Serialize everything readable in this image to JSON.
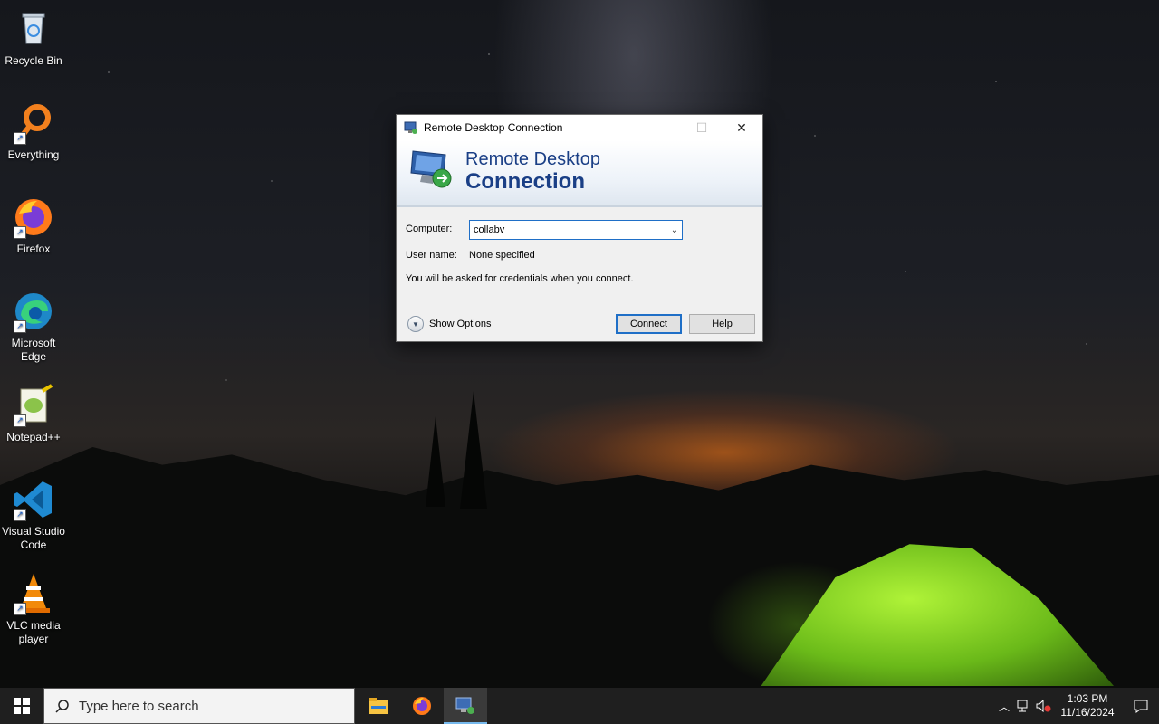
{
  "desktop": {
    "icons": [
      {
        "label": "Recycle Bin",
        "icon": "recycle-bin-icon"
      },
      {
        "label": "Everything",
        "icon": "everything-search-icon"
      },
      {
        "label": "Firefox",
        "icon": "firefox-icon"
      },
      {
        "label": "Microsoft\nEdge",
        "icon": "edge-icon"
      },
      {
        "label": "Notepad++",
        "icon": "notepadpp-icon"
      },
      {
        "label": "Visual Studio\nCode",
        "icon": "vscode-icon"
      },
      {
        "label": "VLC media\nplayer",
        "icon": "vlc-icon"
      }
    ]
  },
  "rdc": {
    "window_title": "Remote Desktop Connection",
    "banner_line1": "Remote Desktop",
    "banner_line2": "Connection",
    "computer_label": "Computer:",
    "computer_value": "collabv",
    "username_label": "User name:",
    "username_value": "None specified",
    "credentials_note": "You will be asked for credentials when you connect.",
    "show_options": "Show Options",
    "connect": "Connect",
    "help": "Help",
    "minimize": "—",
    "maximize": "☐",
    "close": "✕"
  },
  "taskbar": {
    "search_placeholder": "Type here to search",
    "apps": [
      "file-explorer-icon",
      "firefox-icon",
      "remote-desktop-icon"
    ],
    "active_app": "remote-desktop-icon",
    "time": "1:03 PM",
    "date": "11/16/2024"
  },
  "colors": {
    "accent": "#1f6fc7",
    "banner_text": "#1a3f86",
    "taskbar": "#1f1f1f"
  }
}
